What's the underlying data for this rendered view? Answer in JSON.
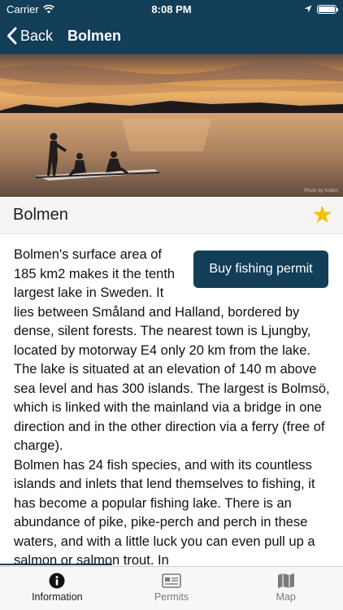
{
  "status_bar": {
    "carrier": "Carrier",
    "time": "8:08 PM",
    "battery_level": 1.0
  },
  "nav": {
    "back_label": "Back",
    "title": "Bolmen"
  },
  "hero": {
    "photo_credit": "Photo by Kollen"
  },
  "lake": {
    "name": "Bolmen",
    "favorite": true
  },
  "buy_button": "Buy fishing permit",
  "description": [
    "Bolmen's surface area of 185 km2 makes it the tenth largest lake in Sweden. It lies between Småland and Halland, bordered by dense, silent forests. The nearest town is Ljungby, located by motorway E4 only 20 km from the lake. The lake is situated at an elevation of 140 m above sea level and has 300 islands. The largest is Bolmsö, which is linked with the mainland via a bridge in one direction and in the other direction via a ferry (free of charge).",
    "Bolmen has 24 fish species, and with its countless islands and inlets that lend themselves to fishing, it has become a popular fishing lake. There is an abundance of pike, pike-perch and perch in these waters, and with a little luck you can even pull up a salmon or salmon trout. In"
  ],
  "tabs": [
    {
      "label": "Information",
      "icon": "info-icon",
      "active": true
    },
    {
      "label": "Permits",
      "icon": "permit-card-icon",
      "active": false
    },
    {
      "label": "Map",
      "icon": "map-icon",
      "active": false
    }
  ],
  "colors": {
    "brand": "#123e57",
    "star": "#f2c200"
  }
}
